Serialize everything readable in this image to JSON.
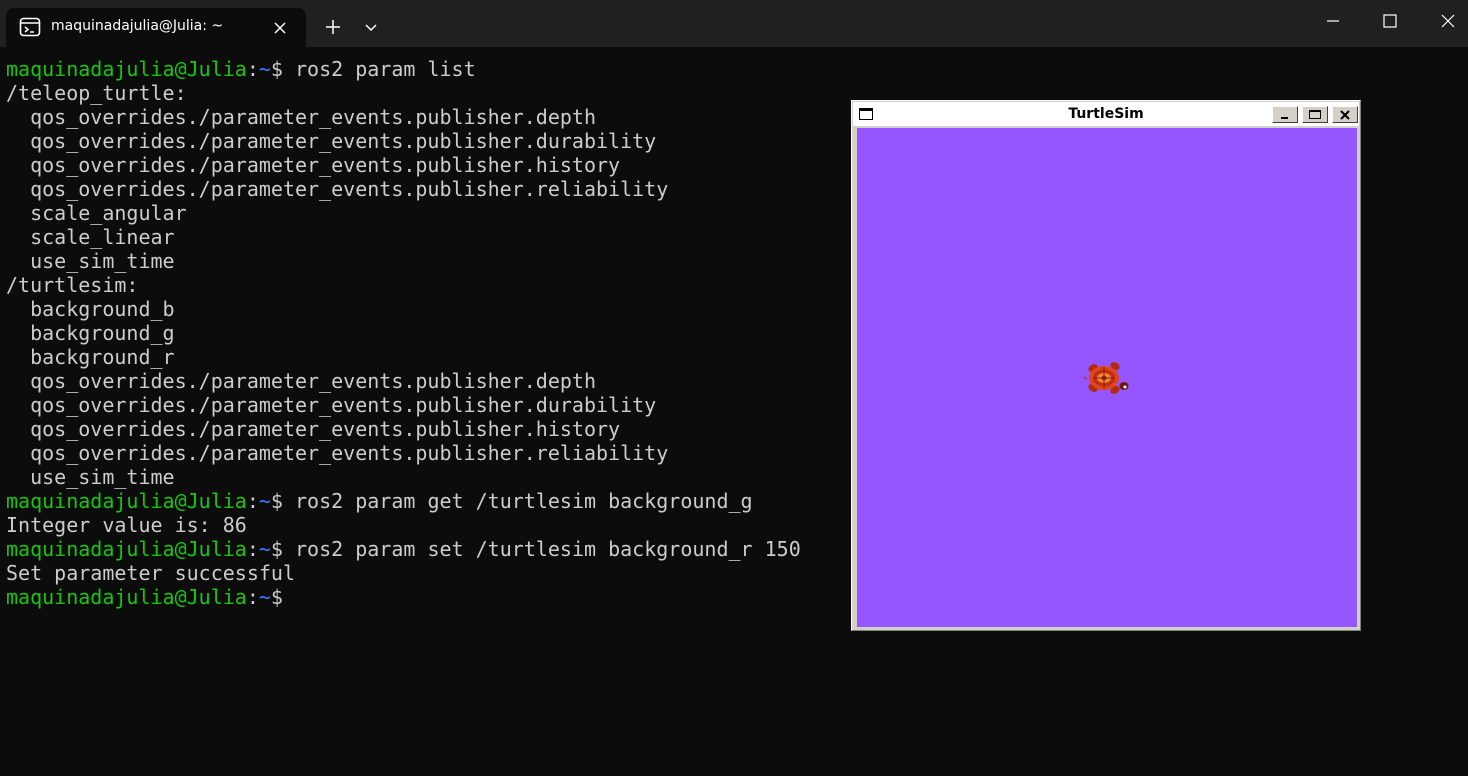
{
  "tab": {
    "title": "maquinadajulia@Julia: ~",
    "icon": "terminal-icon"
  },
  "prompt": {
    "user": "maquinadajulia@Julia",
    "colon": ":",
    "path": "~",
    "dollar": "$"
  },
  "terminal_lines": [
    {
      "type": "cmd",
      "text": " ros2 param list"
    },
    {
      "type": "out",
      "text": "/teleop_turtle:"
    },
    {
      "type": "out",
      "text": "  qos_overrides./parameter_events.publisher.depth"
    },
    {
      "type": "out",
      "text": "  qos_overrides./parameter_events.publisher.durability"
    },
    {
      "type": "out",
      "text": "  qos_overrides./parameter_events.publisher.history"
    },
    {
      "type": "out",
      "text": "  qos_overrides./parameter_events.publisher.reliability"
    },
    {
      "type": "out",
      "text": "  scale_angular"
    },
    {
      "type": "out",
      "text": "  scale_linear"
    },
    {
      "type": "out",
      "text": "  use_sim_time"
    },
    {
      "type": "out",
      "text": "/turtlesim:"
    },
    {
      "type": "out",
      "text": "  background_b"
    },
    {
      "type": "out",
      "text": "  background_g"
    },
    {
      "type": "out",
      "text": "  background_r"
    },
    {
      "type": "out",
      "text": "  qos_overrides./parameter_events.publisher.depth"
    },
    {
      "type": "out",
      "text": "  qos_overrides./parameter_events.publisher.durability"
    },
    {
      "type": "out",
      "text": "  qos_overrides./parameter_events.publisher.history"
    },
    {
      "type": "out",
      "text": "  qos_overrides./parameter_events.publisher.reliability"
    },
    {
      "type": "out",
      "text": "  use_sim_time"
    },
    {
      "type": "cmd",
      "text": " ros2 param get /turtlesim background_g"
    },
    {
      "type": "out",
      "text": "Integer value is: 86"
    },
    {
      "type": "cmd",
      "text": " ros2 param set /turtlesim background_r 150"
    },
    {
      "type": "out",
      "text": "Set parameter successful"
    },
    {
      "type": "cmd",
      "text": ""
    }
  ],
  "turtlesim": {
    "title": "TurtleSim",
    "background_color": "#9556ff"
  },
  "colors": {
    "terminal_bg": "#0c0c0c",
    "prompt_user": "#16c60c",
    "prompt_path": "#3b78ff",
    "text": "#cccccc"
  }
}
